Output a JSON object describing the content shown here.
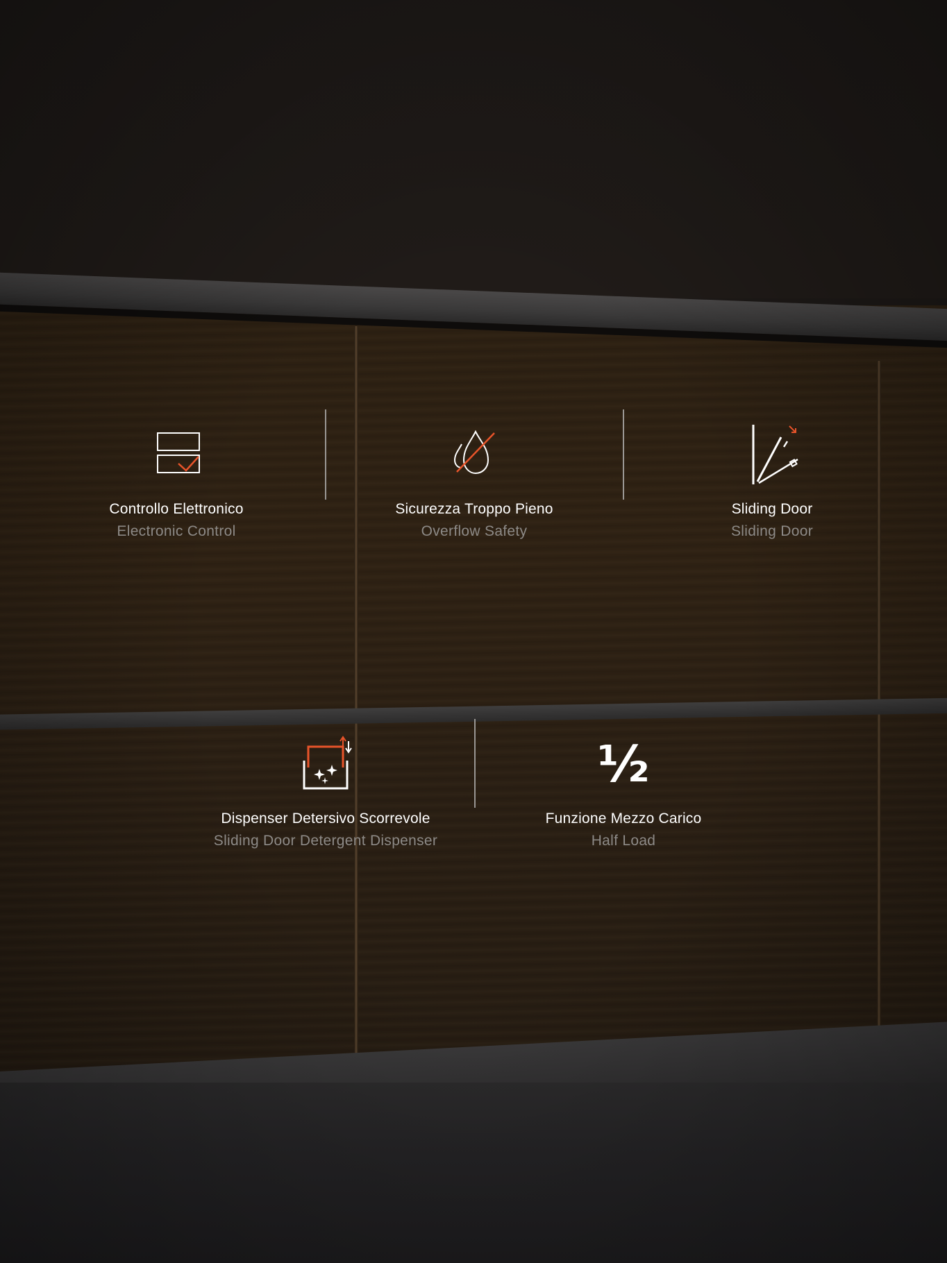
{
  "features": [
    {
      "title": "Controllo Elettronico",
      "subtitle": "Electronic Control",
      "icon": "electronic-control-icon"
    },
    {
      "title": "Sicurezza Troppo Pieno",
      "subtitle": "Overflow Safety",
      "icon": "overflow-safety-icon"
    },
    {
      "title": "Sliding Door",
      "subtitle": "Sliding Door",
      "icon": "sliding-door-icon"
    },
    {
      "title": "Dispenser Detersivo Scorrevole",
      "subtitle": "Sliding Door Detergent Dispenser",
      "icon": "detergent-dispenser-icon"
    },
    {
      "title": "Funzione Mezzo Carico",
      "subtitle": "Half Load",
      "icon": "half-load-icon",
      "glyph": "½"
    }
  ],
  "colors": {
    "accent": "#e8542a",
    "icon_stroke": "#ffffff",
    "title_text": "#ffffff",
    "subtitle_text": "#8d8a87",
    "divider": "#9a9794"
  }
}
